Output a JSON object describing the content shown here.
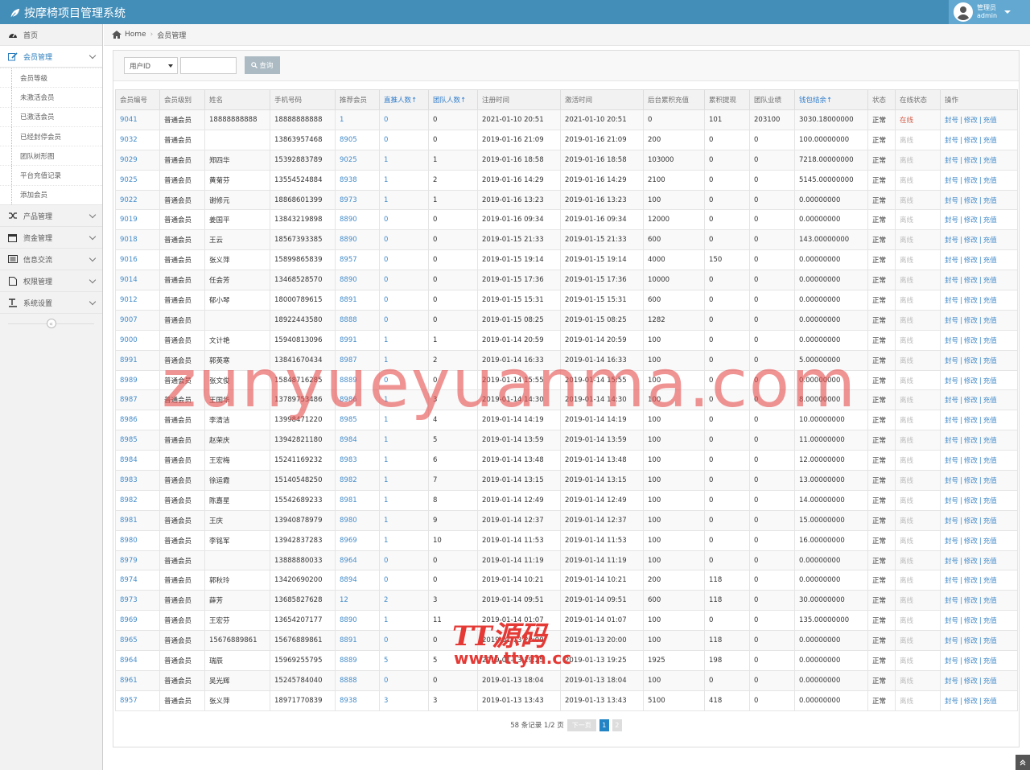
{
  "app": {
    "title": "按摩椅项目管理系统"
  },
  "user": {
    "role": "管理员",
    "name": "admin"
  },
  "sidebar": {
    "items": [
      {
        "label": "首页",
        "icon": "dashboard-icon"
      },
      {
        "label": "会员管理",
        "icon": "edit-icon",
        "open": true,
        "children": [
          "会员等级",
          "未激活会员",
          "已激活会员",
          "已经封停会员",
          "团队树形图",
          "平台充值记录",
          "添加会员"
        ]
      },
      {
        "label": "产品管理",
        "icon": "random-icon"
      },
      {
        "label": "资金管理",
        "icon": "calendar-icon"
      },
      {
        "label": "信息交流",
        "icon": "list-alt-icon"
      },
      {
        "label": "权限管理",
        "icon": "file-icon"
      },
      {
        "label": "系统设置",
        "icon": "text-width-icon"
      }
    ]
  },
  "breadcrumb": {
    "home": "Home",
    "current": "会员管理"
  },
  "search": {
    "field_selected": "用户ID",
    "value": "",
    "button": "查询"
  },
  "table": {
    "columns": [
      "会员编号",
      "会员级别",
      "姓名",
      "手机号码",
      "推荐会员",
      "直推人数↑",
      "团队人数↑",
      "注册时间",
      "激活时间",
      "后台累积充值",
      "累积提现",
      "团队业绩",
      "钱包结余↑",
      "状态",
      "在线状态",
      "操作"
    ],
    "actions": [
      "封号",
      "修改",
      "充值"
    ],
    "rows": [
      [
        "9041",
        "普通会员",
        "18888888888",
        "18888888888",
        "1",
        "0",
        "0",
        "2021-01-10 20:51",
        "2021-01-10 20:51",
        "0",
        "101",
        "203100",
        "3030.18000000",
        "正常",
        "在线"
      ],
      [
        "9032",
        "普通会员",
        "",
        "13863957468",
        "8905",
        "0",
        "0",
        "2019-01-16 21:09",
        "2019-01-16 21:09",
        "200",
        "0",
        "0",
        "100.00000000",
        "正常",
        "离线"
      ],
      [
        "9029",
        "普通会员",
        "郑四华",
        "15392883789",
        "9025",
        "1",
        "1",
        "2019-01-16 18:58",
        "2019-01-16 18:58",
        "103000",
        "0",
        "0",
        "7218.00000000",
        "正常",
        "离线"
      ],
      [
        "9025",
        "普通会员",
        "黄菊芬",
        "13554524884",
        "8938",
        "1",
        "2",
        "2019-01-16 14:29",
        "2019-01-16 14:29",
        "2100",
        "0",
        "0",
        "5145.00000000",
        "正常",
        "离线"
      ],
      [
        "9022",
        "普通会员",
        "谢修元",
        "18868601399",
        "8973",
        "1",
        "1",
        "2019-01-16 13:23",
        "2019-01-16 13:23",
        "100",
        "0",
        "0",
        "0.00000000",
        "正常",
        "离线"
      ],
      [
        "9019",
        "普通会员",
        "姜国平",
        "13843219898",
        "8890",
        "0",
        "0",
        "2019-01-16 09:34",
        "2019-01-16 09:34",
        "12000",
        "0",
        "0",
        "0.00000000",
        "正常",
        "离线"
      ],
      [
        "9018",
        "普通会员",
        "王云",
        "18567393385",
        "8890",
        "0",
        "0",
        "2019-01-15 21:33",
        "2019-01-15 21:33",
        "600",
        "0",
        "0",
        "143.00000000",
        "正常",
        "离线"
      ],
      [
        "9016",
        "普通会员",
        "张义萍",
        "15899865839",
        "8957",
        "0",
        "0",
        "2019-01-15 19:14",
        "2019-01-15 19:14",
        "4000",
        "150",
        "0",
        "0.00000000",
        "正常",
        "离线"
      ],
      [
        "9014",
        "普通会员",
        "任会芳",
        "13468528570",
        "8890",
        "0",
        "0",
        "2019-01-15 17:36",
        "2019-01-15 17:36",
        "10000",
        "0",
        "0",
        "0.00000000",
        "正常",
        "离线"
      ],
      [
        "9012",
        "普通会员",
        "郁小琴",
        "18000789615",
        "8891",
        "0",
        "0",
        "2019-01-15 15:31",
        "2019-01-15 15:31",
        "600",
        "0",
        "0",
        "0.00000000",
        "正常",
        "离线"
      ],
      [
        "9007",
        "普通会员",
        "",
        "18922443580",
        "8888",
        "0",
        "0",
        "2019-01-15 08:25",
        "2019-01-15 08:25",
        "1282",
        "0",
        "0",
        "0.00000000",
        "正常",
        "离线"
      ],
      [
        "9000",
        "普通会员",
        "文计艳",
        "15940813096",
        "8991",
        "1",
        "1",
        "2019-01-14 20:59",
        "2019-01-14 20:59",
        "100",
        "0",
        "0",
        "0.00000000",
        "正常",
        "离线"
      ],
      [
        "8991",
        "普通会员",
        "郭英寒",
        "13841670434",
        "8987",
        "1",
        "2",
        "2019-01-14 16:33",
        "2019-01-14 16:33",
        "100",
        "0",
        "0",
        "5.00000000",
        "正常",
        "离线"
      ],
      [
        "8989",
        "普通会员",
        "张文俊",
        "15848716285",
        "8889",
        "0",
        "0",
        "2019-01-14 15:55",
        "2019-01-14 15:55",
        "100",
        "0",
        "0",
        "0.00000000",
        "正常",
        "离线"
      ],
      [
        "8987",
        "普通会员",
        "王国华",
        "13789753486",
        "8986",
        "1",
        "3",
        "2019-01-14 14:30",
        "2019-01-14 14:30",
        "100",
        "0",
        "0",
        "8.00000000",
        "正常",
        "离线"
      ],
      [
        "8986",
        "普通会员",
        "李清洁",
        "13998471220",
        "8985",
        "1",
        "4",
        "2019-01-14 14:19",
        "2019-01-14 14:19",
        "100",
        "0",
        "0",
        "10.00000000",
        "正常",
        "离线"
      ],
      [
        "8985",
        "普通会员",
        "赵荣庆",
        "13942821180",
        "8984",
        "1",
        "5",
        "2019-01-14 13:59",
        "2019-01-14 13:59",
        "100",
        "0",
        "0",
        "11.00000000",
        "正常",
        "离线"
      ],
      [
        "8984",
        "普通会员",
        "王宏梅",
        "15241169232",
        "8983",
        "1",
        "6",
        "2019-01-14 13:48",
        "2019-01-14 13:48",
        "100",
        "0",
        "0",
        "12.00000000",
        "正常",
        "离线"
      ],
      [
        "8983",
        "普通会员",
        "徐运霞",
        "15140548250",
        "8982",
        "1",
        "7",
        "2019-01-14 13:15",
        "2019-01-14 13:15",
        "100",
        "0",
        "0",
        "13.00000000",
        "正常",
        "离线"
      ],
      [
        "8982",
        "普通会员",
        "陈嘉星",
        "15542689233",
        "8981",
        "1",
        "8",
        "2019-01-14 12:49",
        "2019-01-14 12:49",
        "100",
        "0",
        "0",
        "14.00000000",
        "正常",
        "离线"
      ],
      [
        "8981",
        "普通会员",
        "王庆",
        "13940878979",
        "8980",
        "1",
        "9",
        "2019-01-14 12:37",
        "2019-01-14 12:37",
        "100",
        "0",
        "0",
        "15.00000000",
        "正常",
        "离线"
      ],
      [
        "8980",
        "普通会员",
        "李铭军",
        "13942837283",
        "8969",
        "1",
        "10",
        "2019-01-14 11:53",
        "2019-01-14 11:53",
        "100",
        "0",
        "0",
        "16.00000000",
        "正常",
        "离线"
      ],
      [
        "8979",
        "普通会员",
        "",
        "13888880033",
        "8964",
        "0",
        "0",
        "2019-01-14 11:19",
        "2019-01-14 11:19",
        "100",
        "0",
        "0",
        "0.00000000",
        "正常",
        "离线"
      ],
      [
        "8974",
        "普通会员",
        "郭秋玲",
        "13420690200",
        "8894",
        "0",
        "0",
        "2019-01-14 10:21",
        "2019-01-14 10:21",
        "200",
        "118",
        "0",
        "0.00000000",
        "正常",
        "离线"
      ],
      [
        "8973",
        "普通会员",
        "薛芳",
        "13685827628",
        "12",
        "2",
        "3",
        "2019-01-14 09:51",
        "2019-01-14 09:51",
        "600",
        "118",
        "0",
        "30.00000000",
        "正常",
        "离线"
      ],
      [
        "8969",
        "普通会员",
        "王宏芬",
        "13654207177",
        "8890",
        "1",
        "11",
        "2019-01-14 01:07",
        "2019-01-14 01:07",
        "100",
        "0",
        "0",
        "135.00000000",
        "正常",
        "离线"
      ],
      [
        "8965",
        "普通会员",
        "15676889861",
        "15676889861",
        "8891",
        "0",
        "0",
        "2019-01-13 20:00",
        "2019-01-13 20:00",
        "100",
        "118",
        "0",
        "0.00000000",
        "正常",
        "离线"
      ],
      [
        "8964",
        "普通会员",
        "瑞辰",
        "15969255795",
        "8889",
        "5",
        "5",
        "2019-01-13 19:25",
        "2019-01-13 19:25",
        "1925",
        "198",
        "0",
        "0.00000000",
        "正常",
        "离线"
      ],
      [
        "8961",
        "普通会员",
        "吴光辉",
        "15245784040",
        "8888",
        "0",
        "0",
        "2019-01-13 18:04",
        "2019-01-13 18:04",
        "100",
        "0",
        "0",
        "0.00000000",
        "正常",
        "离线"
      ],
      [
        "8957",
        "普通会员",
        "张义萍",
        "18971770839",
        "8938",
        "3",
        "3",
        "2019-01-13 13:43",
        "2019-01-13 13:43",
        "5100",
        "418",
        "0",
        "0.00000000",
        "正常",
        "离线"
      ]
    ]
  },
  "pager": {
    "summary": "58 条记录 1/2 页",
    "next": "下一页",
    "pages": [
      "1",
      "2"
    ],
    "current": "1"
  },
  "watermarks": {
    "main": "zunyueyuanma.com",
    "logo": "TT源码",
    "url": "www.ttym.cc"
  },
  "colors": {
    "nav": "#438eb9",
    "link": "#428bca",
    "online": "#d15b47",
    "active_page": "#2283c5"
  }
}
